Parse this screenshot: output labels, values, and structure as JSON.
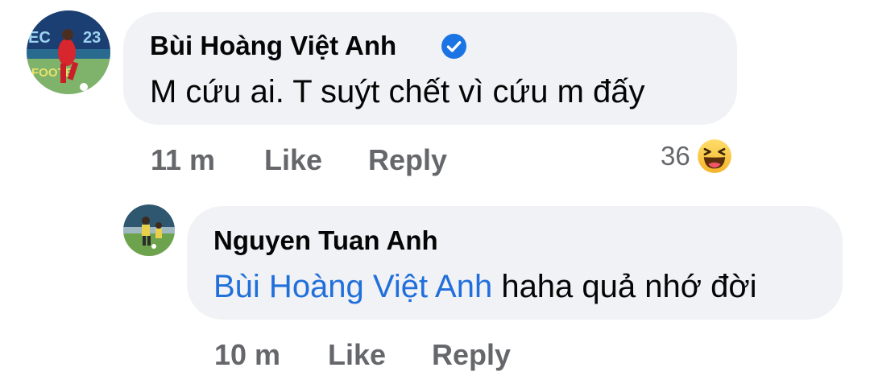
{
  "comments": [
    {
      "author": "Bùi Hoàng Việt Anh",
      "verified": true,
      "text": "M cứu ai. T suýt chết vì cứu m đấy",
      "time": "11 m",
      "like_label": "Like",
      "reply_label": "Reply",
      "reaction_count": "36",
      "reaction_icon": "haha-emoji-icon"
    }
  ],
  "replies": [
    {
      "author": "Nguyen Tuan Anh",
      "mention": "Bùi Hoàng Việt Anh",
      "text": " haha quả nhớ đời",
      "time": "10 m",
      "like_label": "Like",
      "reply_label": "Reply"
    }
  ],
  "colors": {
    "bubble": "#f0f2f5",
    "meta_gray": "#65676b",
    "mention_blue": "#216fdb",
    "verified_blue": "#1b74e4"
  }
}
